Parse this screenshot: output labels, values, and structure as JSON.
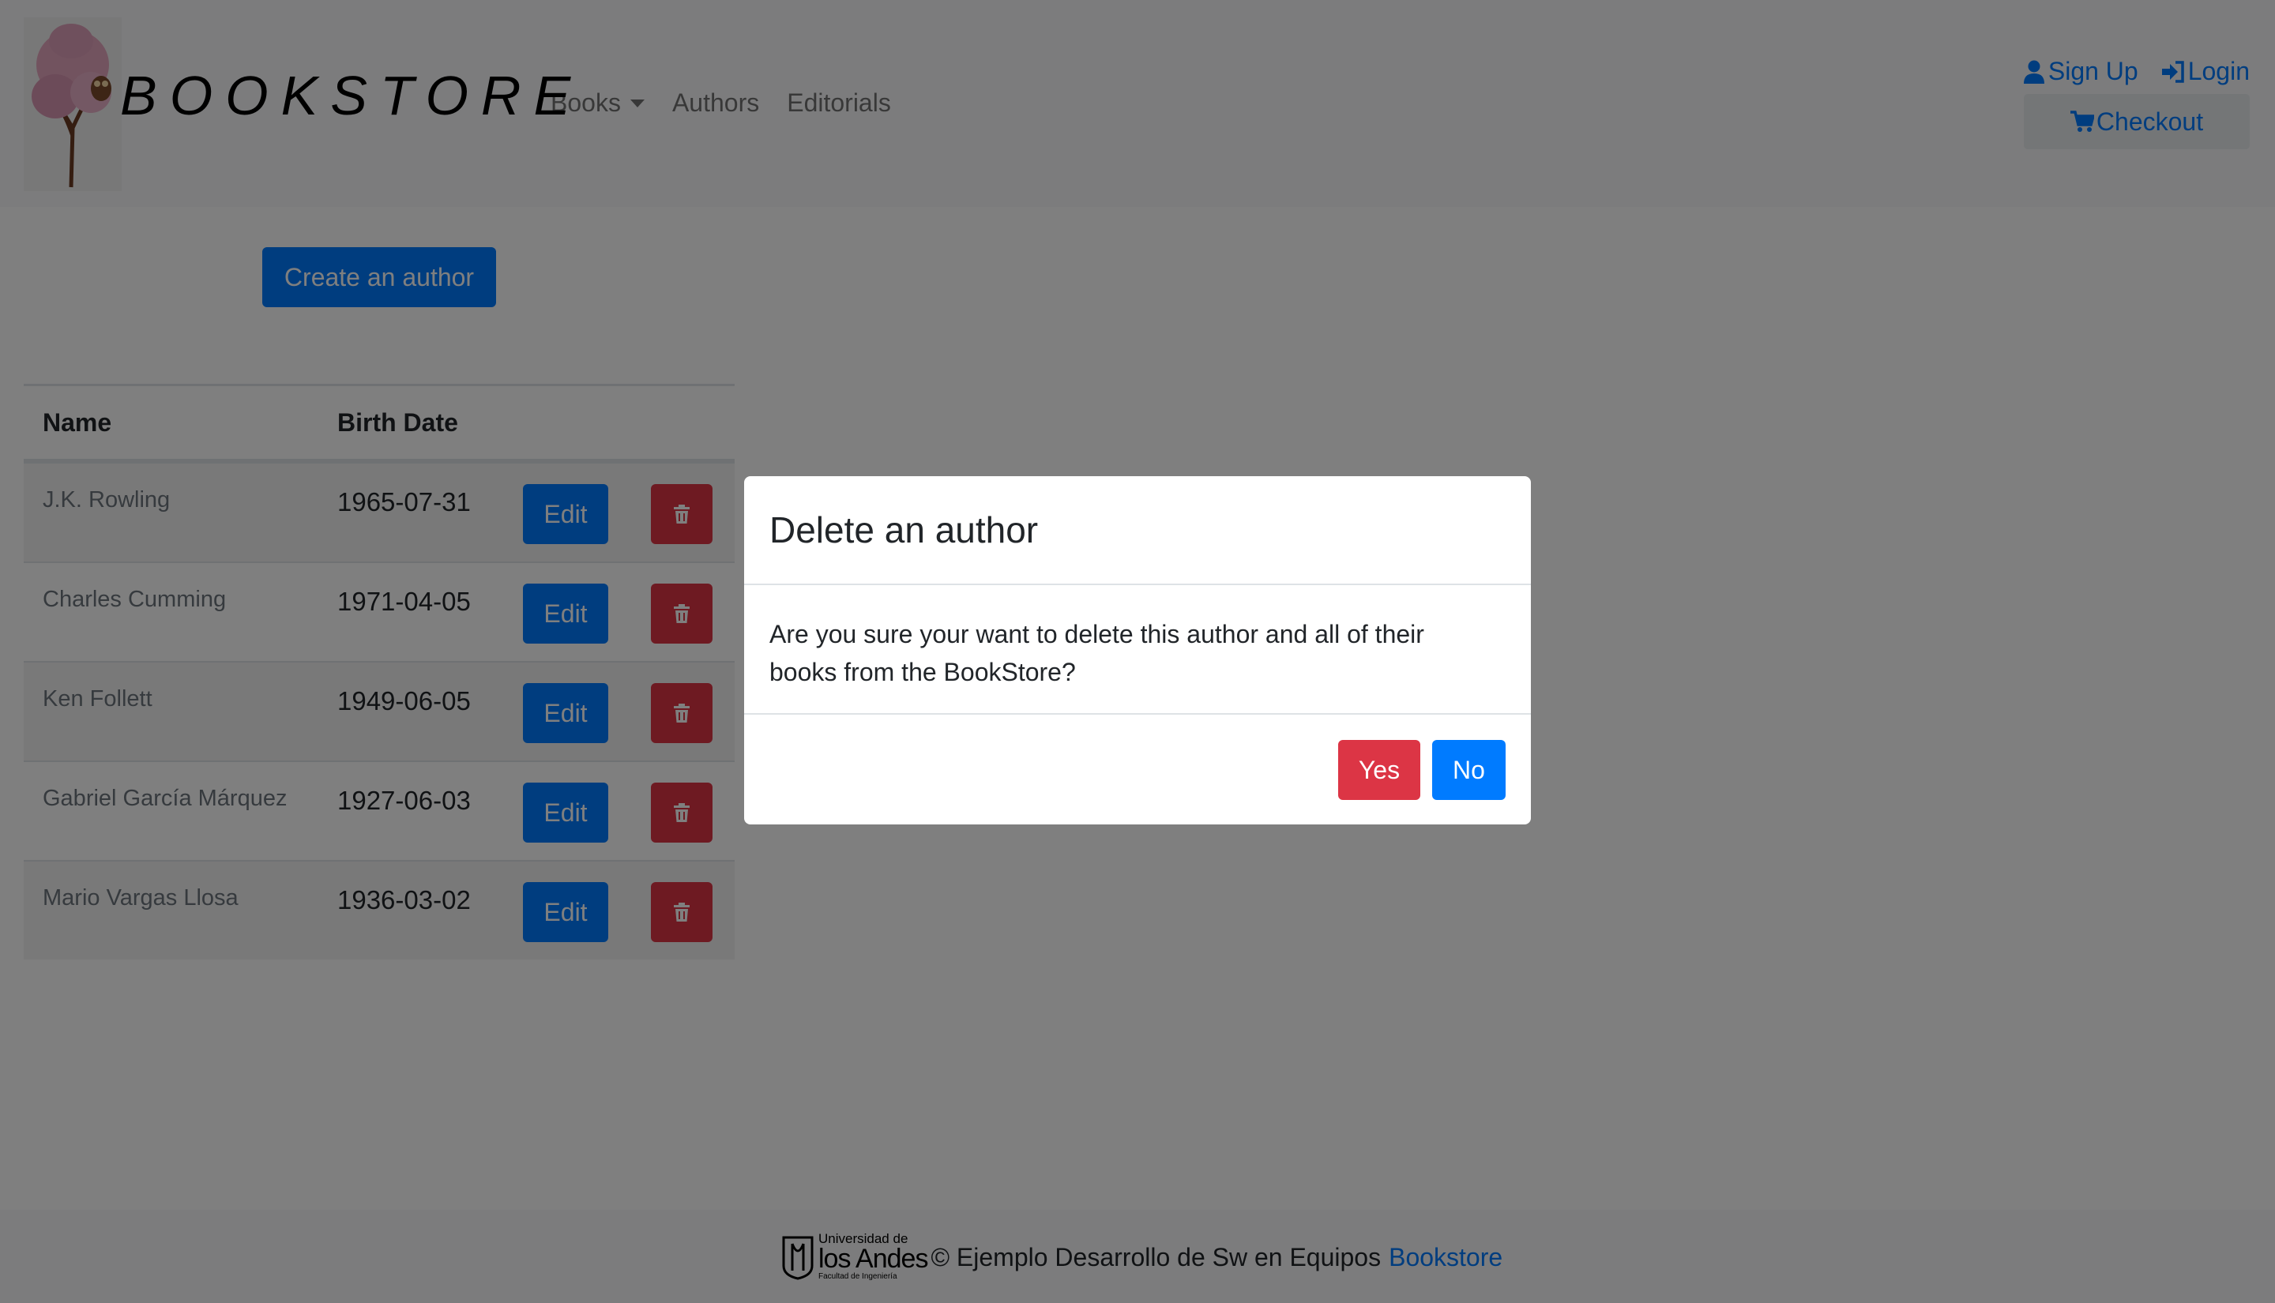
{
  "navbar": {
    "brand": "BOOKSTORE",
    "links": [
      {
        "label": "Books",
        "dropdown": true
      },
      {
        "label": "Authors",
        "dropdown": false
      },
      {
        "label": "Editorials",
        "dropdown": false
      }
    ],
    "signup_label": "Sign Up",
    "login_label": "Login",
    "checkout_label": "Checkout"
  },
  "main": {
    "create_button_label": "Create an author",
    "table": {
      "headers": [
        "Name",
        "Birth Date"
      ],
      "rows": [
        {
          "name": "J.K. Rowling",
          "birth_date": "1965-07-31",
          "edit_label": "Edit"
        },
        {
          "name": "Charles Cumming",
          "birth_date": "1971-04-05",
          "edit_label": "Edit"
        },
        {
          "name": "Ken Follett",
          "birth_date": "1949-06-05",
          "edit_label": "Edit"
        },
        {
          "name": "Gabriel García Márquez",
          "birth_date": "1927-06-03",
          "edit_label": "Edit"
        },
        {
          "name": "Mario Vargas Llosa",
          "birth_date": "1936-03-02",
          "edit_label": "Edit"
        }
      ]
    }
  },
  "modal": {
    "title": "Delete an author",
    "body_line1": "Are you sure your want to delete this author and all of their",
    "body_line2": "books from the BookStore?",
    "yes_label": "Yes",
    "no_label": "No"
  },
  "footer": {
    "logo_top": "Universidad de",
    "logo_main": "los Andes",
    "logo_sub": "Facultad de Ingeniería",
    "text": "© Ejemplo Desarrollo de Sw en Equipos",
    "link_label": "Bookstore"
  },
  "icons": {
    "user": "user-icon",
    "login": "sign-in-icon",
    "cart": "shopping-cart-icon",
    "trash": "trash-icon",
    "caret": "caret-down-icon"
  },
  "colors": {
    "primary": "#007bff",
    "danger": "#dc3545",
    "navbar_bg": "#f8f9fa",
    "checkout_bg": "#e9ecef"
  }
}
